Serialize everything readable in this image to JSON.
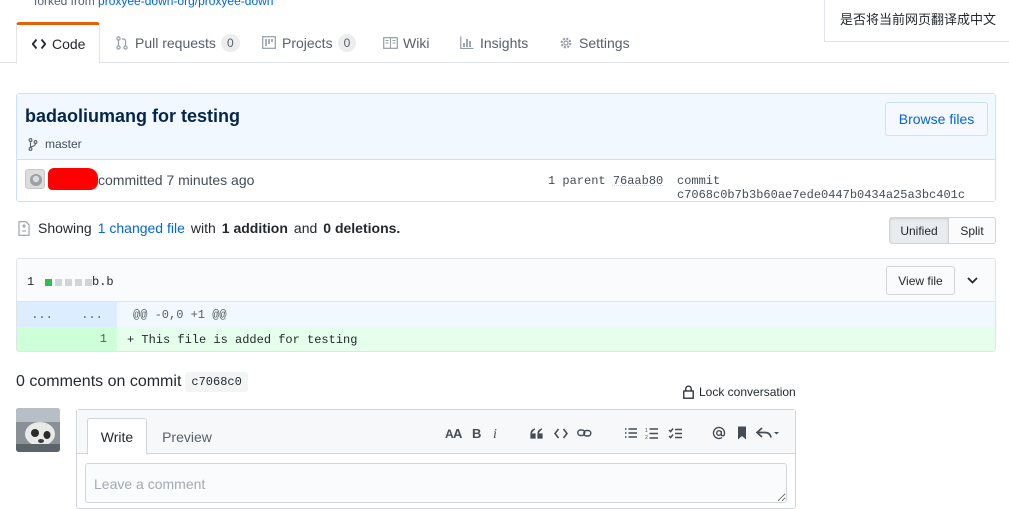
{
  "fork": {
    "prefix": "forked from",
    "repo": "proxyee-down-org/proxyee-down"
  },
  "translate_prompt": "是否将当前网页翻译成中文",
  "tabs": [
    {
      "label": "Code",
      "icon": "code-icon",
      "active": true
    },
    {
      "label": "Pull requests",
      "count": "0",
      "icon": "pull-request-icon"
    },
    {
      "label": "Projects",
      "count": "0",
      "icon": "project-icon"
    },
    {
      "label": "Wiki",
      "icon": "book-icon"
    },
    {
      "label": "Insights",
      "icon": "graph-icon"
    },
    {
      "label": "Settings",
      "icon": "gear-icon"
    }
  ],
  "commit": {
    "title": "badaoliumang for testing",
    "branch": "master",
    "browse_label": "Browse files",
    "committed_text": "committed 7 minutes ago",
    "parent_label": "1 parent",
    "parent_sha": "76aab80",
    "commit_label": "commit",
    "commit_sha": "c7068c0b7b3b60ae7ede0447b0434a25a3bc401c"
  },
  "diff_summary": {
    "showing": "Showing",
    "changed_files": "1 changed file",
    "with": "with",
    "additions": "1 addition",
    "and": "and",
    "deletions": "0 deletions."
  },
  "view_toggle": {
    "unified": "Unified",
    "split": "Split",
    "selected": "Unified"
  },
  "file": {
    "change_count": "1",
    "name": "b.b",
    "view_file_label": "View file",
    "hunk_left": "...",
    "hunk_right": "...",
    "hunk_header": "@@ -0,0 +1 @@",
    "added_line_number": "1",
    "added_line": "+ This file is added for testing",
    "diffstat_blocks": [
      "added",
      "neutral",
      "neutral",
      "neutral",
      "neutral"
    ]
  },
  "comments": {
    "heading": "0 comments on commit",
    "short_sha": "c7068c0",
    "lock_label": "Lock conversation",
    "write_tab": "Write",
    "preview_tab": "Preview",
    "placeholder": "Leave a comment",
    "toolbar": [
      "header-icon",
      "bold-icon",
      "italic-icon",
      "quote-icon",
      "code-icon",
      "link-icon",
      "bulleted-list-icon",
      "numbered-list-icon",
      "task-list-icon",
      "mention-icon",
      "bookmark-icon",
      "reply-icon"
    ]
  },
  "colors": {
    "link": "#0366d6",
    "tab_accent": "#e36209",
    "commit_bg": "#f1f8ff",
    "added_bg": "#e6ffed",
    "diffstat_added": "#2cbe4e",
    "diffstat_neutral": "#d1d5da",
    "redaction": "#ff0000"
  }
}
